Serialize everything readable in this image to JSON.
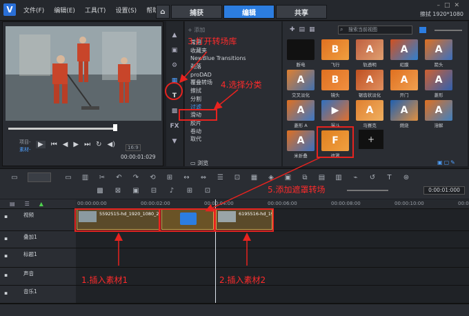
{
  "menu": [
    "文件(F)",
    "编辑(E)",
    "工具(T)",
    "设置(S)",
    "帮助(H)"
  ],
  "tabs": {
    "capture": "捕获",
    "edit": "编辑",
    "share": "共享"
  },
  "project_info": "擦拭  1920*1080",
  "player": {
    "mode_project": "项目-",
    "mode_clip": "素材-",
    "timecode": "00:00:01:029",
    "size": "16:9"
  },
  "library": {
    "add_label": "添加",
    "search_placeholder": "搜索当前视图",
    "browse_label": "浏览",
    "categories": [
      "常用",
      "收藏夹",
      "NewBlue Transitions",
      "剥落",
      "proDAD",
      "覆叠转场",
      "擦拭",
      "分割",
      "过滤",
      "滑动",
      "胶片",
      "卷动",
      "取代"
    ],
    "selected_category": "过滤",
    "transitions": [
      "断电",
      "飞行",
      "轨透明",
      "虹膜",
      "箭头",
      "交叉淡化",
      "镜头",
      "锯齿状淡化",
      "开门",
      "菱形",
      "菱形 A",
      "漏斗",
      "马赛克",
      "燃烧",
      "溶解",
      "米折叠",
      "遮罩"
    ],
    "selected_transition": "遮罩"
  },
  "timeline": {
    "timecode": "0:00:01:000",
    "ruler": [
      "00:00:00:00",
      "00:00:02:00",
      "00:00:04:00",
      "00:00:06:00",
      "00:00:08:00",
      "00:00:10:00",
      "00:00:12:00"
    ],
    "tracks": [
      "视频",
      "叠加1",
      "标题1",
      "声音",
      "音乐1"
    ],
    "clip1": "5592515-hd_1920_1080_25",
    "clip2": "6195516-hd_19"
  },
  "annotations": {
    "step1": "1.插入素材1",
    "step2": "2.插入素材2",
    "step3": "3.打开转场库",
    "step4": "4.选择分类",
    "step5": "5.添加遮罩转场"
  },
  "colors": {
    "accent": "#2c7de0",
    "annotation": "#e8231f",
    "clip_border": "#d8a34a"
  }
}
